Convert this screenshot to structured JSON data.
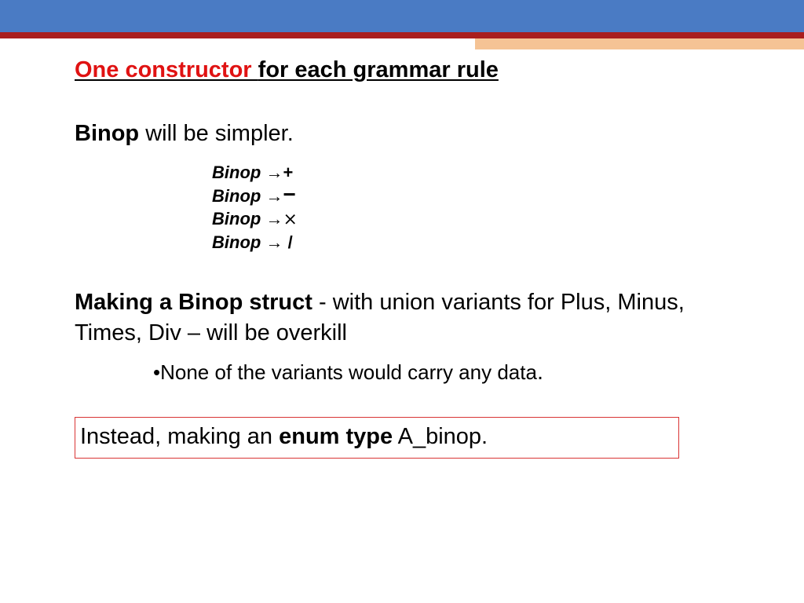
{
  "title": {
    "part1": "One constructor ",
    "part2": " for each grammar rule"
  },
  "intro": {
    "bold": "Binop",
    "rest": "  will be simpler."
  },
  "grammar": {
    "label": "Binop",
    "arrow": "→",
    "r1": "+",
    "r2": "−",
    "r3": "⨯",
    "r4": " /"
  },
  "paragraph": {
    "bold": "Making a Binop struct",
    "rest": " - with union variants for Plus, Minus, Times, Div – will be overkill"
  },
  "bullet_text": "None of the variants would carry any data",
  "bullet_dot": ".",
  "box": {
    "pre": "Instead, making an ",
    "bold": "enum type",
    "post": "  A_binop."
  }
}
